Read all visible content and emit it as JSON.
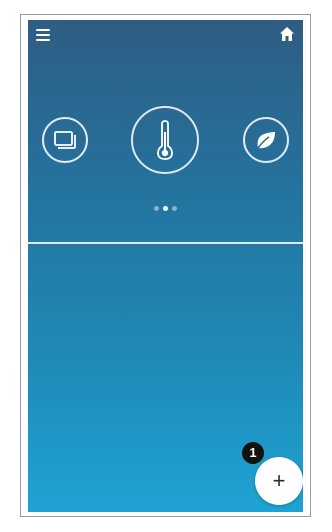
{
  "header": {
    "menu_icon": "hamburger-menu-icon",
    "home_icon": "home-icon"
  },
  "modes": {
    "items": [
      {
        "icon": "display-panels-icon",
        "selected": false
      },
      {
        "icon": "thermometer-icon",
        "selected": true
      },
      {
        "icon": "leaf-icon",
        "selected": false
      }
    ]
  },
  "pager": {
    "count": 3,
    "active_index": 1
  },
  "fab": {
    "label": "+"
  },
  "callout": {
    "number": "1"
  },
  "colors": {
    "gradient_top": "#2f5d83",
    "gradient_bottom": "#1fa3d3",
    "foreground": "#ffffff"
  }
}
